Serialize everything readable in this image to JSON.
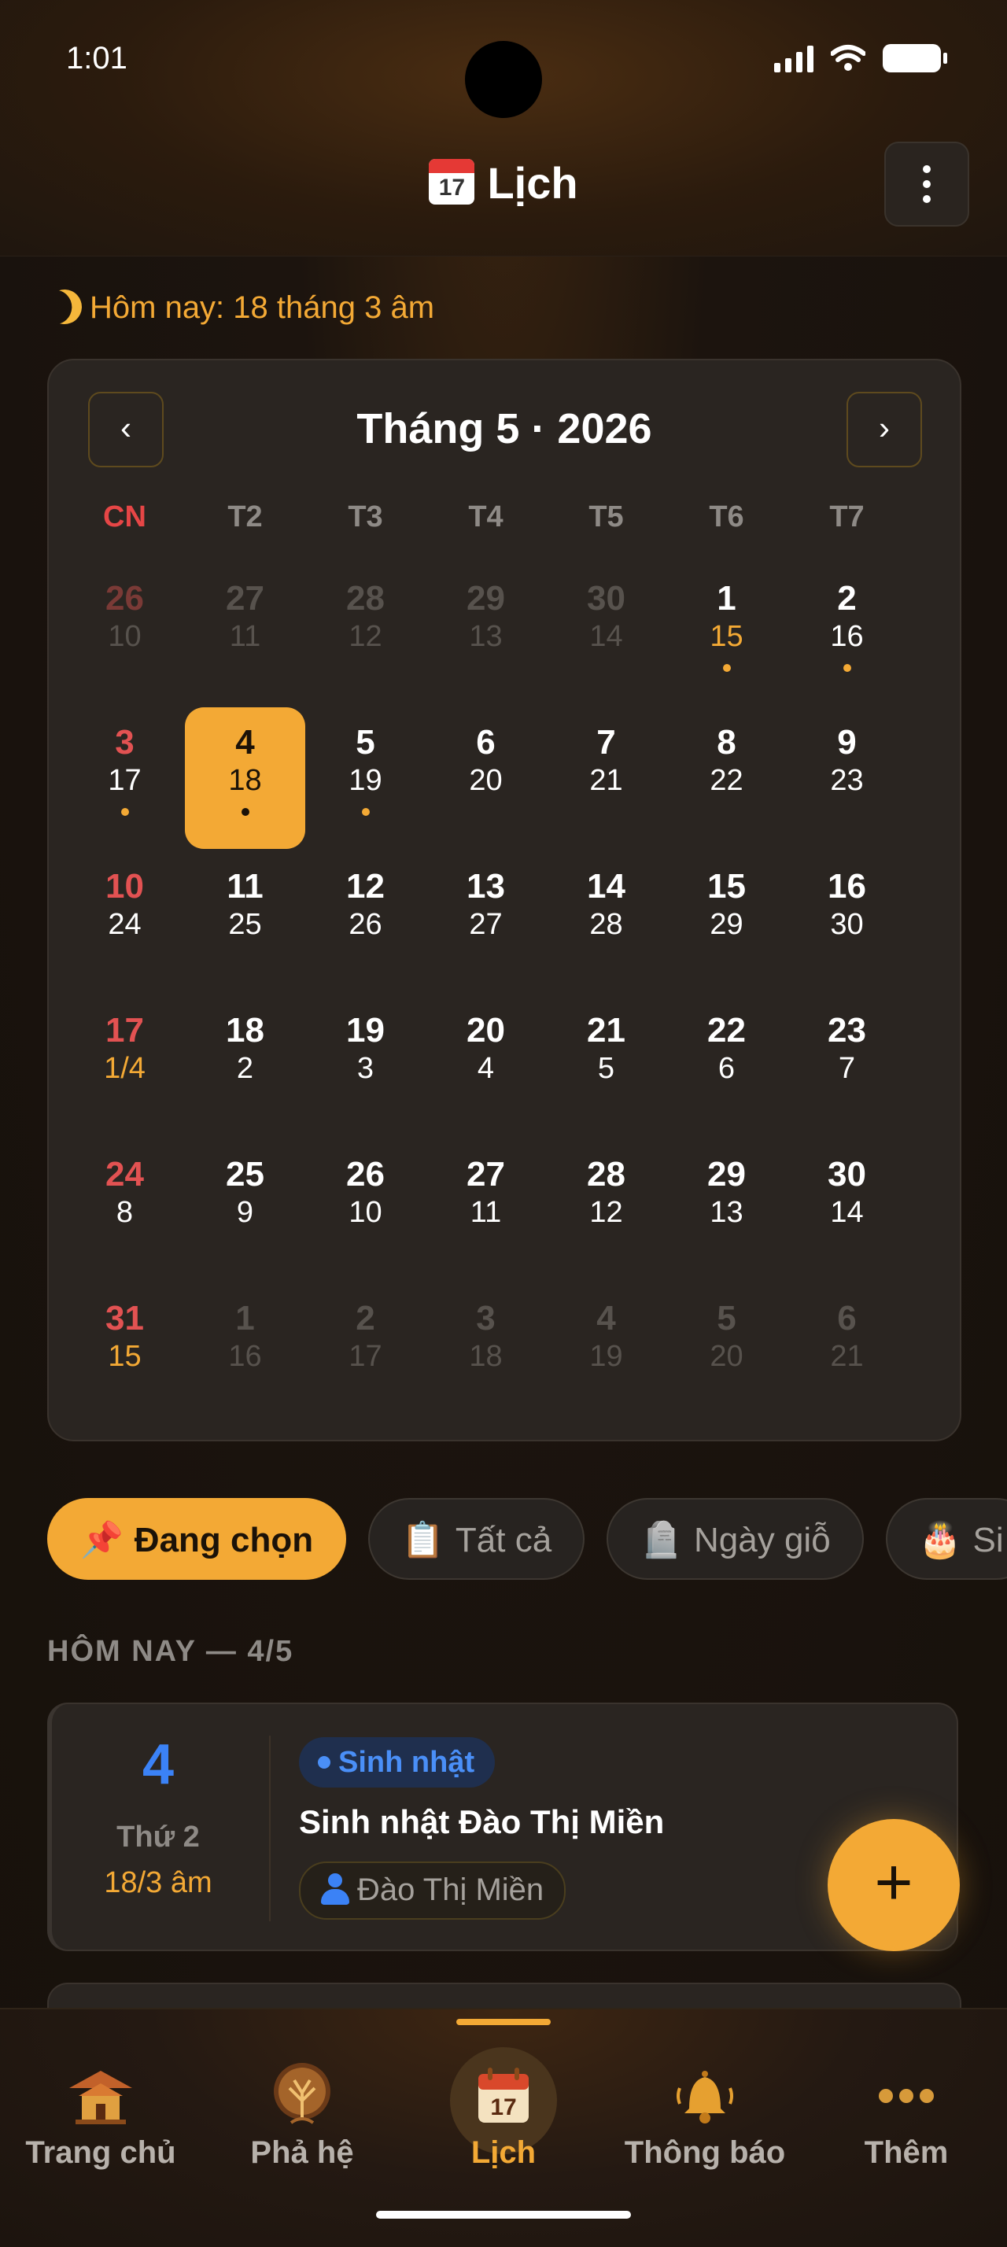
{
  "status": {
    "time": "1:01"
  },
  "header": {
    "title": "Lịch",
    "calendar_icon_day": "17",
    "menu_icon": "more-vertical-icon"
  },
  "today_lunar": "Hôm nay: 18 tháng 3 âm",
  "calendar": {
    "month_title": "Tháng 5 · 2026",
    "prev_label": "‹",
    "next_label": "›",
    "weekdays": [
      "CN",
      "T2",
      "T3",
      "T4",
      "T5",
      "T6",
      "T7"
    ],
    "weeks": [
      [
        {
          "s": "26",
          "l": "10",
          "o": true
        },
        {
          "s": "27",
          "l": "11",
          "o": true
        },
        {
          "s": "28",
          "l": "12",
          "o": true
        },
        {
          "s": "29",
          "l": "13",
          "o": true
        },
        {
          "s": "30",
          "l": "14",
          "o": true
        },
        {
          "s": "1",
          "l": "15",
          "hl": true,
          "dot": true
        },
        {
          "s": "2",
          "l": "16",
          "dot": true
        }
      ],
      [
        {
          "s": "3",
          "l": "17",
          "dot": true
        },
        {
          "s": "4",
          "l": "18",
          "sel": true,
          "dot": true
        },
        {
          "s": "5",
          "l": "19",
          "dot": true
        },
        {
          "s": "6",
          "l": "20"
        },
        {
          "s": "7",
          "l": "21"
        },
        {
          "s": "8",
          "l": "22"
        },
        {
          "s": "9",
          "l": "23"
        }
      ],
      [
        {
          "s": "10",
          "l": "24"
        },
        {
          "s": "11",
          "l": "25"
        },
        {
          "s": "12",
          "l": "26"
        },
        {
          "s": "13",
          "l": "27"
        },
        {
          "s": "14",
          "l": "28"
        },
        {
          "s": "15",
          "l": "29"
        },
        {
          "s": "16",
          "l": "30"
        }
      ],
      [
        {
          "s": "17",
          "l": "1/4",
          "hl": true
        },
        {
          "s": "18",
          "l": "2"
        },
        {
          "s": "19",
          "l": "3"
        },
        {
          "s": "20",
          "l": "4"
        },
        {
          "s": "21",
          "l": "5"
        },
        {
          "s": "22",
          "l": "6"
        },
        {
          "s": "23",
          "l": "7"
        }
      ],
      [
        {
          "s": "24",
          "l": "8"
        },
        {
          "s": "25",
          "l": "9"
        },
        {
          "s": "26",
          "l": "10"
        },
        {
          "s": "27",
          "l": "11"
        },
        {
          "s": "28",
          "l": "12"
        },
        {
          "s": "29",
          "l": "13"
        },
        {
          "s": "30",
          "l": "14"
        }
      ],
      [
        {
          "s": "31",
          "l": "15",
          "hl": true
        },
        {
          "s": "1",
          "l": "16",
          "o": true
        },
        {
          "s": "2",
          "l": "17",
          "o": true
        },
        {
          "s": "3",
          "l": "18",
          "o": true
        },
        {
          "s": "4",
          "l": "19",
          "o": true
        },
        {
          "s": "5",
          "l": "20",
          "o": true
        },
        {
          "s": "6",
          "l": "21",
          "o": true
        }
      ]
    ]
  },
  "filters": [
    {
      "icon": "📌",
      "label": "Đang chọn",
      "active": true
    },
    {
      "icon": "📋",
      "label": "Tất cả"
    },
    {
      "icon": "🪦",
      "label": "Ngày giỗ"
    },
    {
      "icon": "🎂",
      "label": "Si"
    }
  ],
  "section_title": "HÔM NAY — 4/5",
  "event": {
    "day": "4",
    "weekday": "Thứ 2",
    "lunar": "18/3 âm",
    "badge": "Sinh nhật",
    "title": "Sinh nhật Đào Thị Miền",
    "person": "Đào Thị Miền"
  },
  "fab_label": "+",
  "nav": [
    {
      "label": "Trang chủ",
      "icon": "temple-icon"
    },
    {
      "label": "Phả hệ",
      "icon": "tree-icon"
    },
    {
      "label": "Lịch",
      "icon": "calendar-icon",
      "active": true
    },
    {
      "label": "Thông báo",
      "icon": "bell-icon"
    },
    {
      "label": "Thêm",
      "icon": "more-dots-icon"
    }
  ],
  "colors": {
    "accent": "#f3a935",
    "sunday": "#e25252",
    "birthday": "#3b82f6",
    "background": "#17110c"
  }
}
